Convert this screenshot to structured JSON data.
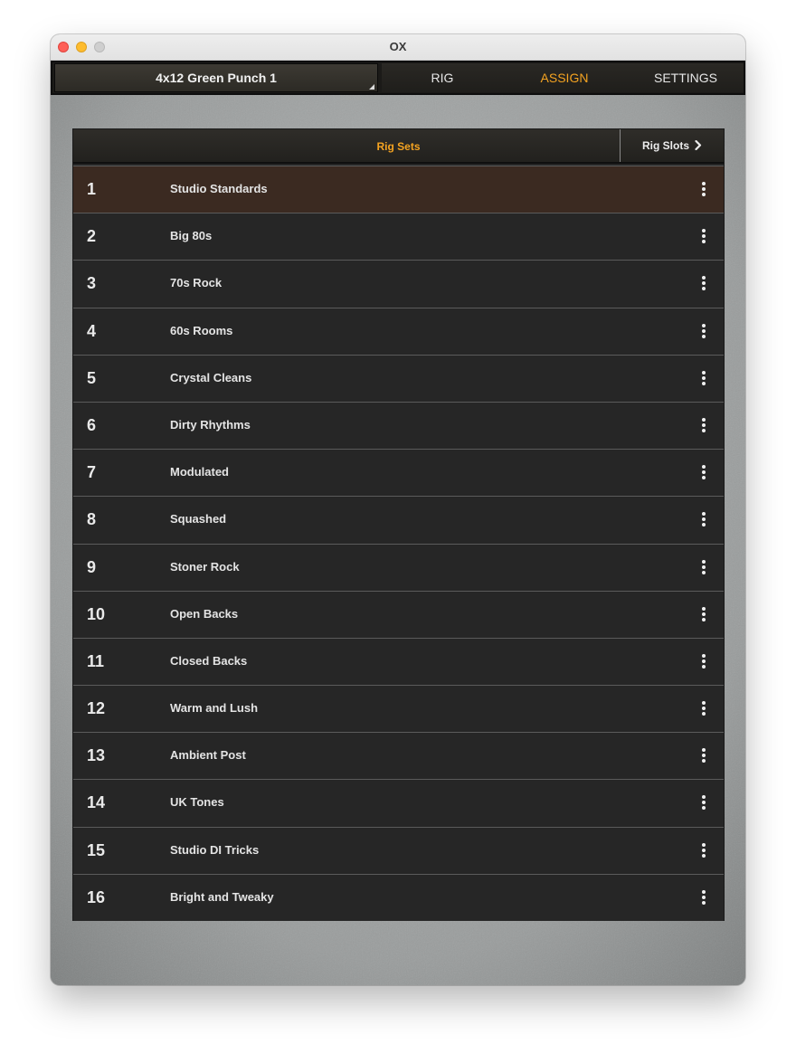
{
  "window": {
    "title": "OX"
  },
  "topbar": {
    "preset_name": "4x12 Green Punch 1",
    "tabs": [
      {
        "label": "RIG",
        "active": false
      },
      {
        "label": "ASSIGN",
        "active": true
      },
      {
        "label": "SETTINGS",
        "active": false
      }
    ]
  },
  "panel": {
    "header_title": "Rig Sets",
    "rig_slots_label": "Rig Slots",
    "rig_slots_icon": "chevron-right-icon",
    "row_menu_icon": "more-vertical-icon",
    "accent_color": "#f4a321",
    "selected_row_color": "#3b2a21",
    "rows": [
      {
        "number": "1",
        "name": "Studio Standards",
        "selected": true
      },
      {
        "number": "2",
        "name": "Big 80s"
      },
      {
        "number": "3",
        "name": "70s Rock"
      },
      {
        "number": "4",
        "name": "60s Rooms"
      },
      {
        "number": "5",
        "name": "Crystal Cleans"
      },
      {
        "number": "6",
        "name": "Dirty Rhythms"
      },
      {
        "number": "7",
        "name": "Modulated"
      },
      {
        "number": "8",
        "name": "Squashed"
      },
      {
        "number": "9",
        "name": "Stoner Rock"
      },
      {
        "number": "10",
        "name": "Open Backs"
      },
      {
        "number": "11",
        "name": "Closed Backs"
      },
      {
        "number": "12",
        "name": "Warm and Lush"
      },
      {
        "number": "13",
        "name": "Ambient Post"
      },
      {
        "number": "14",
        "name": "UK Tones"
      },
      {
        "number": "15",
        "name": "Studio DI Tricks"
      },
      {
        "number": "16",
        "name": "Bright and Tweaky"
      }
    ]
  }
}
